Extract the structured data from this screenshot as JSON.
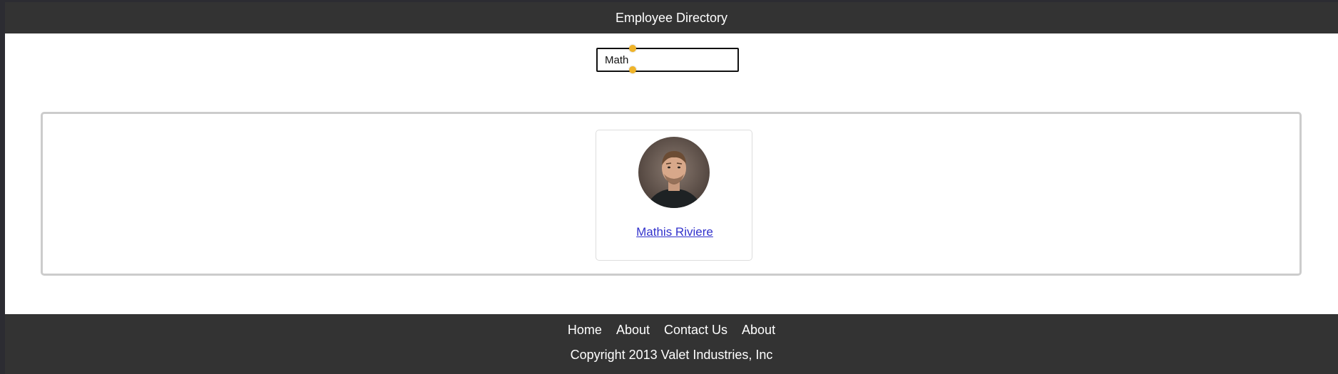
{
  "header": {
    "title": "Employee Directory"
  },
  "search": {
    "value": "Math",
    "placeholder": ""
  },
  "results": {
    "employees": [
      {
        "name": "Mathis Riviere",
        "avatar_icon": "person-photo"
      }
    ]
  },
  "footer": {
    "nav": [
      "Home",
      "About",
      "Contact Us",
      "About"
    ],
    "copyright": "Copyright 2013 Valet Industries, Inc"
  },
  "colors": {
    "header_bg": "#333333",
    "footer_bg": "#333333",
    "link": "#3333cc",
    "cursor_dot": "#f0b429"
  }
}
